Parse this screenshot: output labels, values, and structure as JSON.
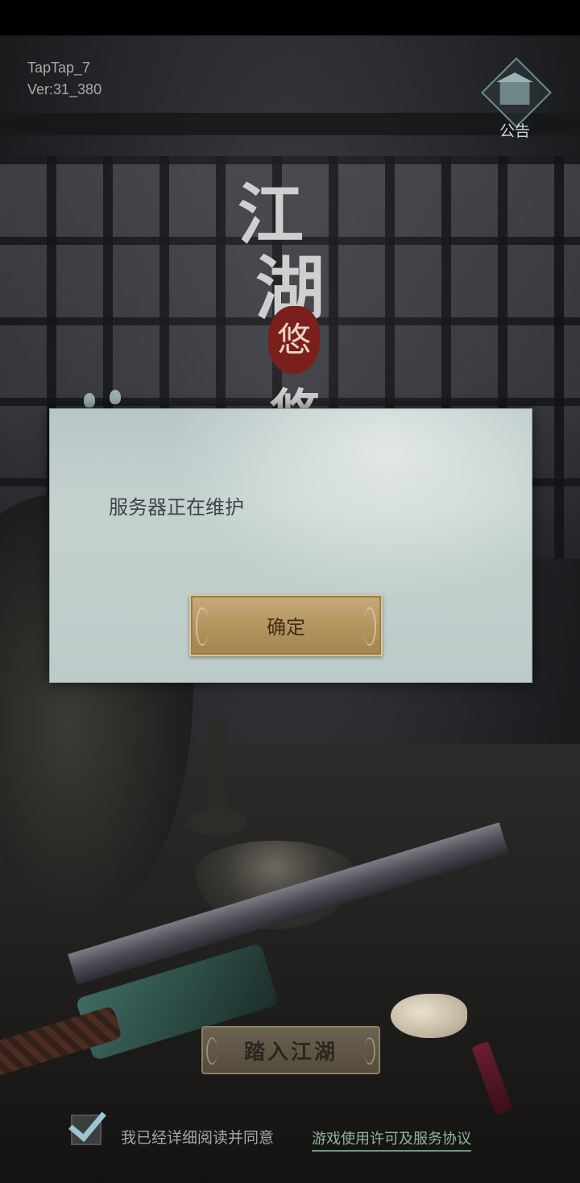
{
  "header": {
    "channel": "TapTap_7",
    "version": "Ver:31_380"
  },
  "notice": {
    "label": "公告",
    "icon": "pavilion-icon"
  },
  "logo": {
    "chars": [
      "江",
      "湖",
      "悠",
      "悠"
    ]
  },
  "dialog": {
    "message": "服务器正在维护",
    "confirm_label": "确定"
  },
  "enter_button": {
    "label": "踏入江湖"
  },
  "consent": {
    "text": "我已经详细阅读并同意",
    "link": "游戏使用许可及服务协议",
    "checked": true
  },
  "colors": {
    "dialog_bg": "#bccbc9",
    "confirm_button": "#b2925d",
    "link": "#8fb79a",
    "seal": "#7a1f1c"
  }
}
